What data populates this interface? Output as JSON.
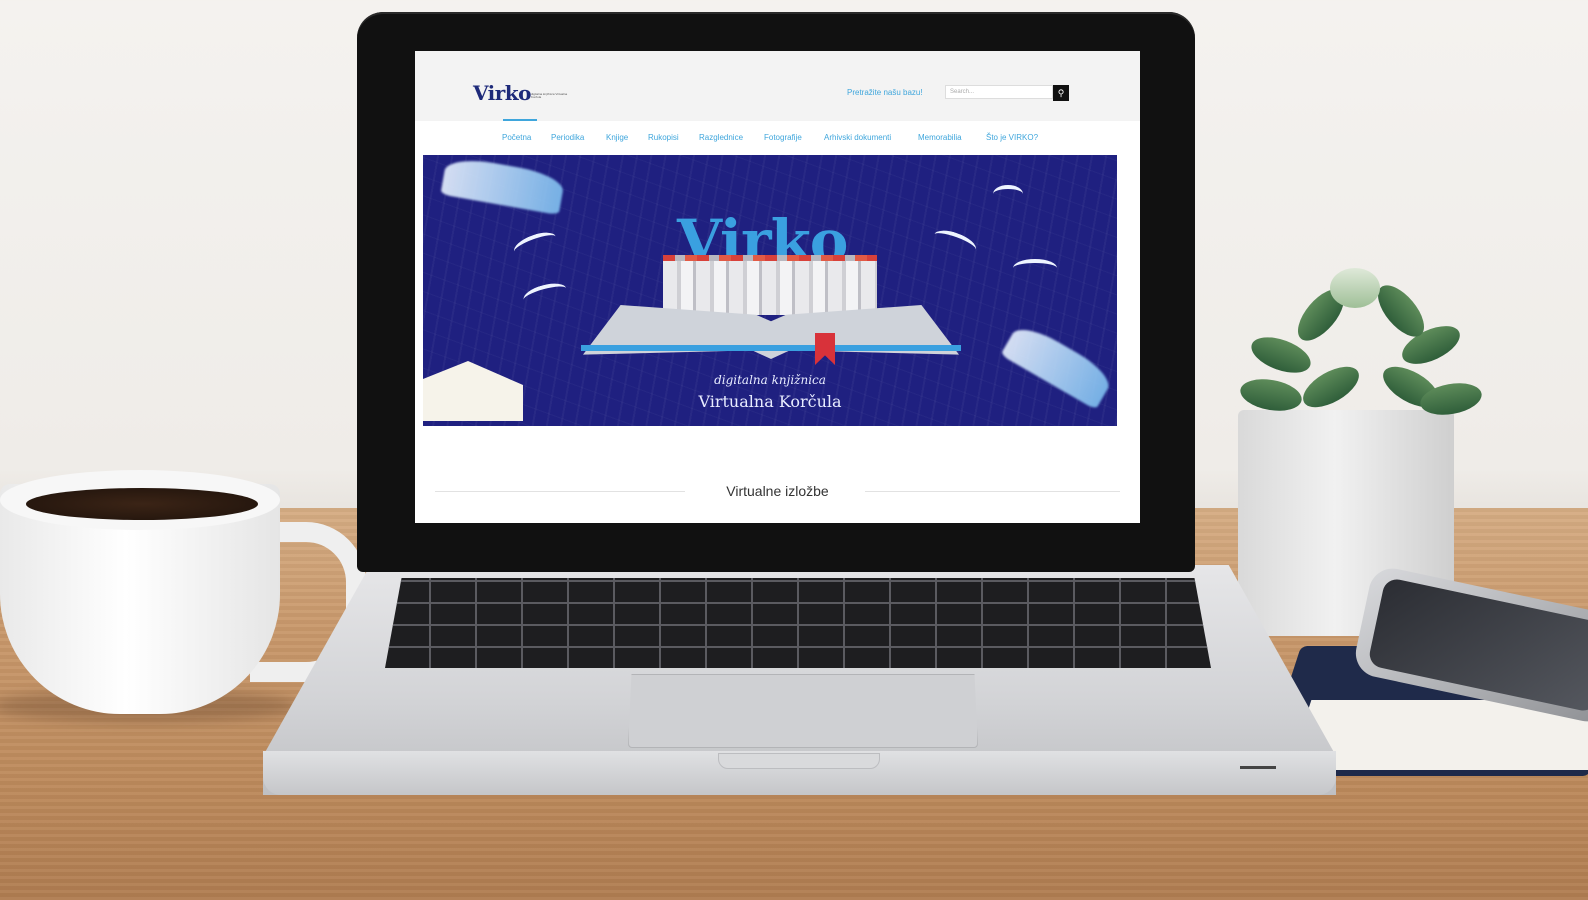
{
  "site": {
    "logo_text": "Virko",
    "logo_tagline": "digitalna knjižnica Virtualna Korčula",
    "search_prompt": "Pretražite našu bazu!",
    "search_placeholder": "Search...",
    "search_icon": "search-icon",
    "nav": [
      "Početna",
      "Periodika",
      "Knjige",
      "Rukopisi",
      "Razglednice",
      "Fotografije",
      "Arhivski dokumenti",
      "Memorabilia",
      "Što je VIRKO?"
    ],
    "active_nav": "Početna",
    "banner": {
      "title": "Virko",
      "subtitle_1": "digitalna knjižnica",
      "subtitle_2": "Virtualna Korčula"
    },
    "section_title": "Virtualne izložbe",
    "colors": {
      "accent": "#3fa6dc",
      "banner_bg": "#1f2080",
      "logo": "#1e2a7a"
    }
  }
}
